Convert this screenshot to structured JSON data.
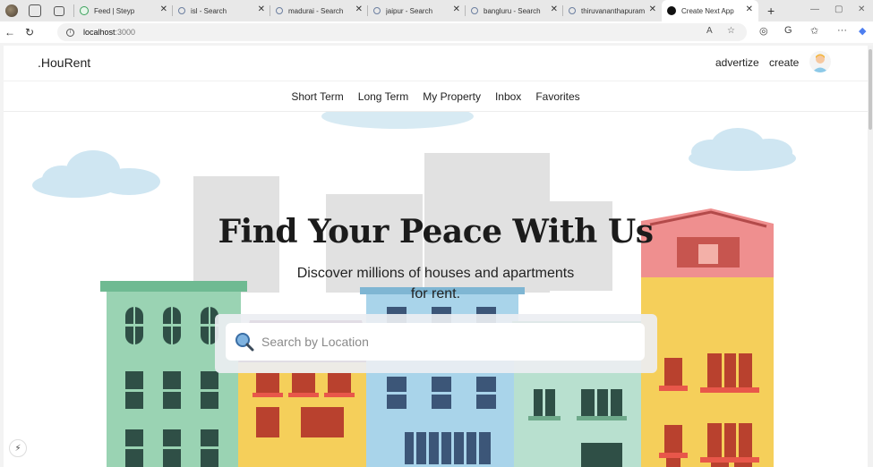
{
  "browser": {
    "tabs": [
      {
        "label": "Feed | Steyp",
        "icon": "steyp"
      },
      {
        "label": "isl - Search",
        "icon": "search"
      },
      {
        "label": "madurai - Search",
        "icon": "search"
      },
      {
        "label": "jaipur - Search",
        "icon": "search"
      },
      {
        "label": "bangluru - Search",
        "icon": "search"
      },
      {
        "label": "thiruvananthapuram",
        "icon": "search"
      },
      {
        "label": "Create Next App",
        "icon": "next",
        "active": true
      }
    ],
    "url_host": "localhost",
    "url_port": ":3000"
  },
  "header": {
    "logo": ".HouRent",
    "advertize": "advertize",
    "create": "create"
  },
  "menu": [
    "Short Term",
    "Long Term",
    "My Property",
    "Inbox",
    "Favorites"
  ],
  "hero": {
    "headline": "Find Your Peace With Us",
    "subline": "Discover millions of houses and apartments for rent."
  },
  "search": {
    "placeholder": "Search by Location"
  },
  "colors": {
    "green_building": "#9ad3b3",
    "yellow_building": "#f5cf5a",
    "blue_building": "#a9d4ea",
    "pink_roof": "#ef8f8f",
    "cloud": "#cfe6f2"
  }
}
